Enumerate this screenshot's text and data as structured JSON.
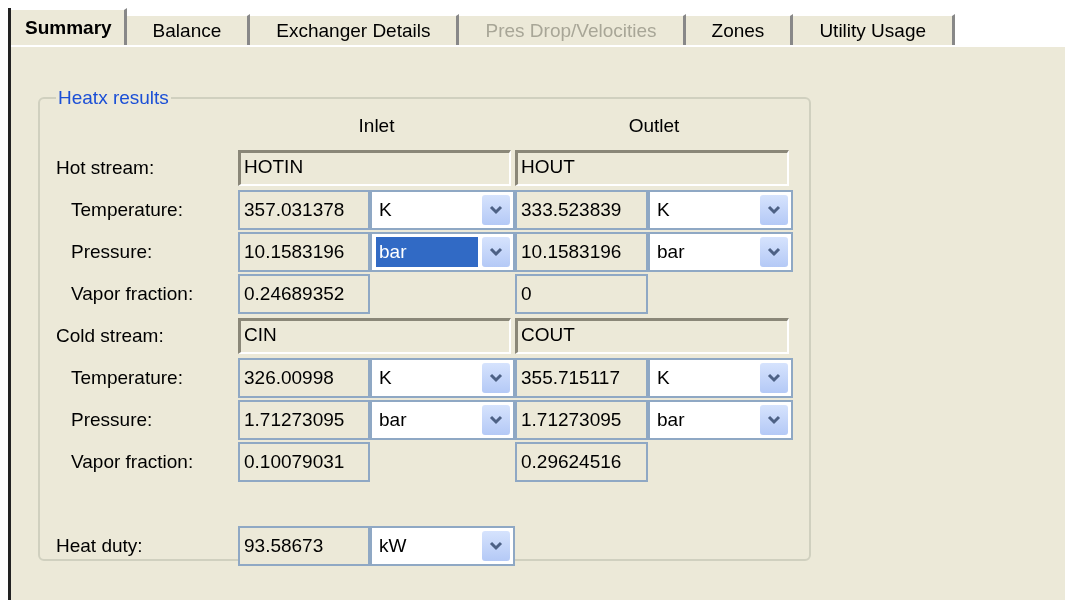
{
  "tabs": [
    {
      "label": "Summary",
      "selected": true,
      "disabled": false
    },
    {
      "label": "Balance",
      "selected": false,
      "disabled": false
    },
    {
      "label": "Exchanger Details",
      "selected": false,
      "disabled": false
    },
    {
      "label": "Pres Drop/Velocities",
      "selected": false,
      "disabled": true
    },
    {
      "label": "Zones",
      "selected": false,
      "disabled": false
    },
    {
      "label": "Utility Usage",
      "selected": false,
      "disabled": false
    }
  ],
  "group": {
    "title": "Heatx results",
    "columns": [
      "Inlet",
      "Outlet"
    ],
    "streams": [
      {
        "label": "Hot stream:",
        "inlet_name": "HOTIN",
        "outlet_name": "HOUT",
        "properties": [
          {
            "label": "Temperature:",
            "inlet": {
              "value": "357.031378",
              "unit": "K",
              "unit_selected": false
            },
            "outlet": {
              "value": "333.523839",
              "unit": "K",
              "unit_selected": false
            }
          },
          {
            "label": "Pressure:",
            "inlet": {
              "value": "10.1583196",
              "unit": "bar",
              "unit_selected": true
            },
            "outlet": {
              "value": "10.1583196",
              "unit": "bar",
              "unit_selected": false
            }
          },
          {
            "label": "Vapor fraction:",
            "inlet": {
              "value": "0.24689352"
            },
            "outlet": {
              "value": "0"
            }
          }
        ]
      },
      {
        "label": "Cold stream:",
        "inlet_name": "CIN",
        "outlet_name": "COUT",
        "properties": [
          {
            "label": "Temperature:",
            "inlet": {
              "value": "326.00998",
              "unit": "K",
              "unit_selected": false
            },
            "outlet": {
              "value": "355.715117",
              "unit": "K",
              "unit_selected": false
            }
          },
          {
            "label": "Pressure:",
            "inlet": {
              "value": "1.71273095",
              "unit": "bar",
              "unit_selected": false
            },
            "outlet": {
              "value": "1.71273095",
              "unit": "bar",
              "unit_selected": false
            }
          },
          {
            "label": "Vapor fraction:",
            "inlet": {
              "value": "0.10079031"
            },
            "outlet": {
              "value": "0.29624516"
            }
          }
        ]
      }
    ],
    "heat_duty": {
      "label": "Heat duty:",
      "value": "93.58673",
      "unit": "kW",
      "unit_selected": false
    }
  }
}
